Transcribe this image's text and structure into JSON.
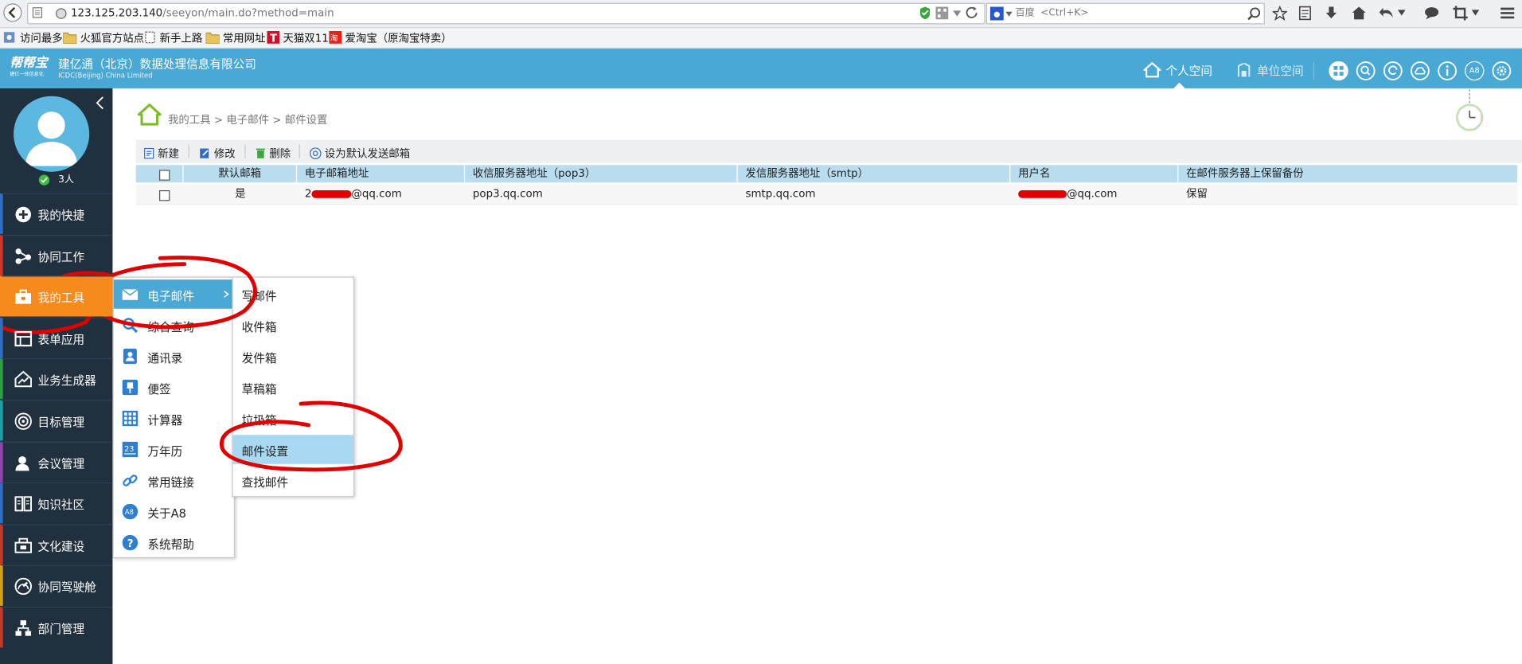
{
  "browser": {
    "url_host": "123.125.203.140",
    "url_path": "/seeyon/main.do?method=main",
    "search_engine": "百度",
    "search_placeholder": "<Ctrl+K>",
    "bookmarks": [
      {
        "label": "访问最多",
        "icon": "gear-icon"
      },
      {
        "label": "火狐官方站点",
        "icon": "folder-icon"
      },
      {
        "label": "新手上路",
        "icon": "page-icon"
      },
      {
        "label": "常用网址",
        "icon": "folder-icon"
      },
      {
        "label": "天猫双11",
        "icon": "tmall-icon"
      },
      {
        "label": "爱淘宝（原淘宝特卖）",
        "icon": "taobao-icon"
      }
    ]
  },
  "header": {
    "logo_text": "帮帮宝",
    "logo_sub": "建亿一体信息化",
    "company_name": "建亿通（北京）数据处理信息有限公司",
    "company_en": "ICDC(Beijing) China Limited",
    "nav_personal": "个人空间",
    "nav_unit": "单位空间",
    "a8_label": "A8",
    "accent": "#4aa8d4"
  },
  "sidebar": {
    "online_count": "3人",
    "items": [
      {
        "label": "我的快捷",
        "icon": "plus-circle-icon",
        "stripe": "#2f6fc1"
      },
      {
        "label": "协同工作",
        "icon": "share-icon",
        "stripe": "#d0342c"
      },
      {
        "label": "我的工具",
        "icon": "toolbox-icon",
        "stripe": "#f57c00"
      },
      {
        "label": "表单应用",
        "icon": "form-icon",
        "stripe": "#2f6fc1"
      },
      {
        "label": "业务生成器",
        "icon": "house-chart-icon",
        "stripe": "#2f9e44"
      },
      {
        "label": "目标管理",
        "icon": "target-icon",
        "stripe": "#1aa0a0"
      },
      {
        "label": "会议管理",
        "icon": "meeting-icon",
        "stripe": "#8e44ad"
      },
      {
        "label": "知识社区",
        "icon": "book-icon",
        "stripe": "#2f6fc1"
      },
      {
        "label": "文化建设",
        "icon": "culture-icon",
        "stripe": "#c0392b"
      },
      {
        "label": "协同驾驶舱",
        "icon": "gauge-icon",
        "stripe": "#d4a017"
      },
      {
        "label": "部门管理",
        "icon": "org-icon",
        "stripe": "#c0392b"
      }
    ]
  },
  "tools_menu": [
    {
      "label": "电子邮件",
      "icon": "mail-icon"
    },
    {
      "label": "综合查询",
      "icon": "search-icon"
    },
    {
      "label": "通讯录",
      "icon": "contacts-icon"
    },
    {
      "label": "便签",
      "icon": "pin-icon"
    },
    {
      "label": "计算器",
      "icon": "calculator-icon"
    },
    {
      "label": "万年历",
      "icon": "calendar-icon",
      "calendar_day": "23"
    },
    {
      "label": "常用链接",
      "icon": "link-icon"
    },
    {
      "label": "关于A8",
      "icon": "a8-icon",
      "badge": "A8"
    },
    {
      "label": "系统帮助",
      "icon": "help-icon"
    }
  ],
  "mail_submenu": [
    "写邮件",
    "收件箱",
    "发件箱",
    "草稿箱",
    "垃圾箱",
    "邮件设置",
    "查找邮件"
  ],
  "breadcrumb": {
    "parts": [
      "我的工具",
      "电子邮件",
      "邮件设置"
    ],
    "sep": ">"
  },
  "toolbar": {
    "new": "新建",
    "edit": "修改",
    "delete": "删除",
    "set_default": "设为默认发送邮箱"
  },
  "table": {
    "headers": [
      "默认邮箱",
      "电子邮箱地址",
      "收信服务器地址（pop3）",
      "发信服务器地址（smtp）",
      "用户名",
      "在邮件服务器上保留备份"
    ],
    "rows": [
      {
        "default": "是",
        "email_suffix": "@qq.com",
        "pop3": "pop3.qq.com",
        "smtp": "smtp.qq.com",
        "username_suffix": "@qq.com",
        "backup": "保留"
      }
    ]
  }
}
